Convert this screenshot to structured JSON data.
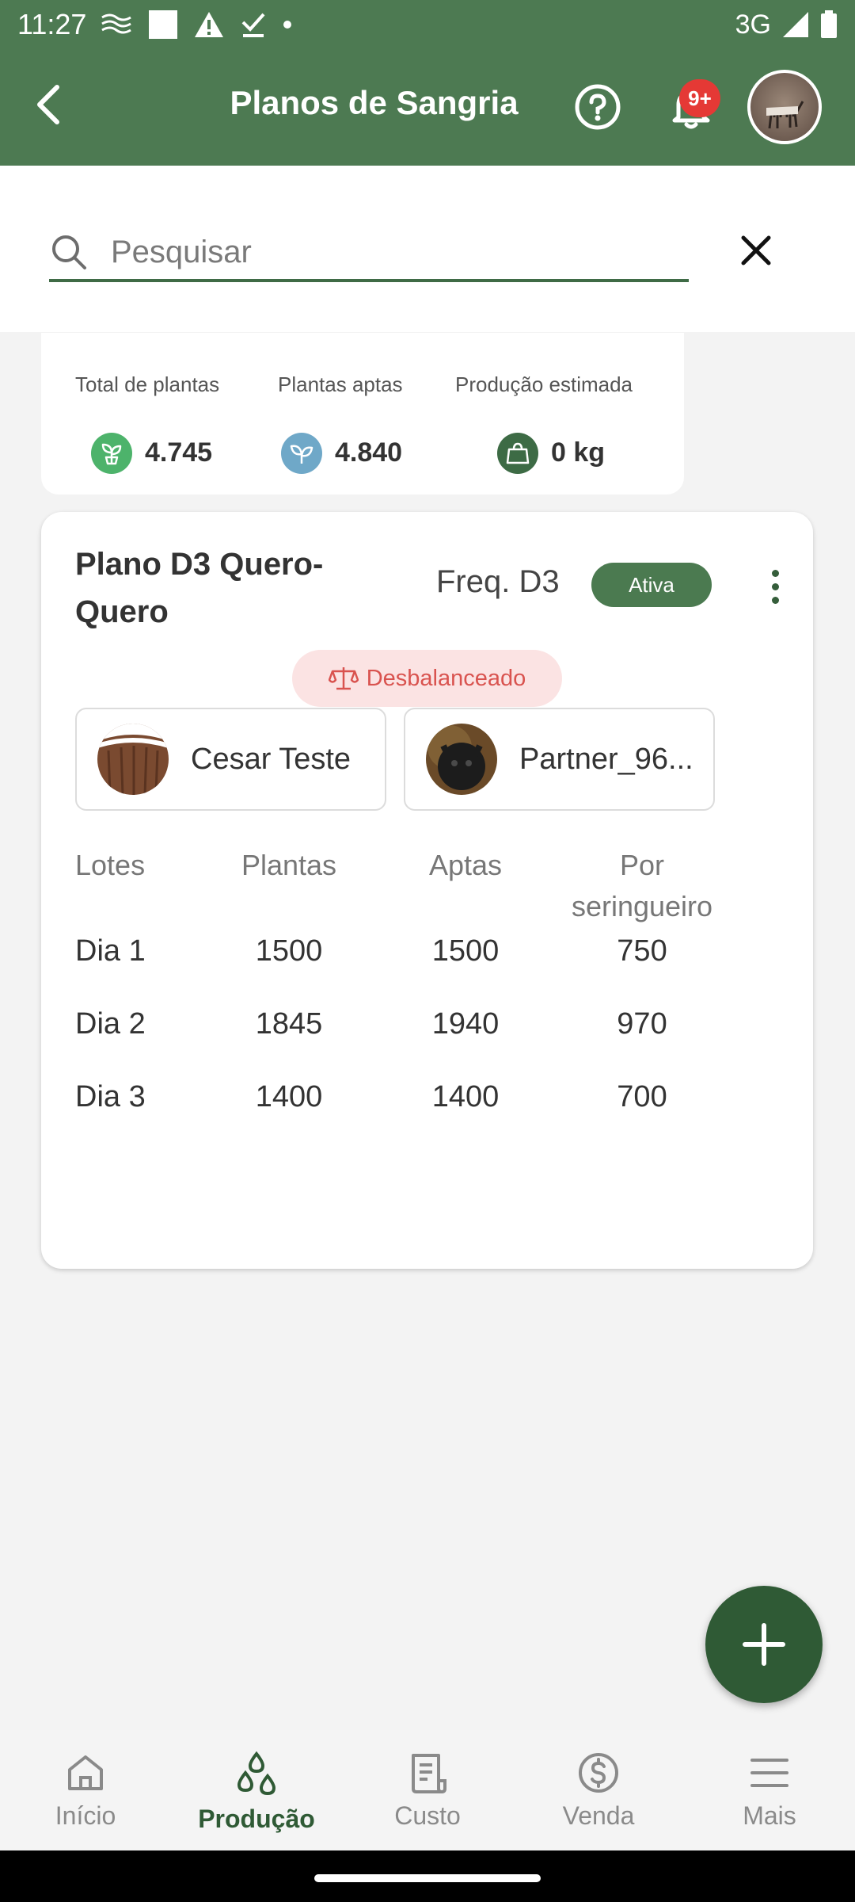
{
  "status_bar": {
    "time": "11:27",
    "network": "3G",
    "icons": [
      "signal-waves-icon",
      "square-icon",
      "warning-icon",
      "check-download-icon",
      "dot-icon"
    ]
  },
  "header": {
    "title": "Planos de Sangria",
    "notification_badge": "9+",
    "background_color": "#4d7a52"
  },
  "search": {
    "placeholder": "Pesquisar",
    "value": ""
  },
  "summary": {
    "total_label": "Total de plantas",
    "total_value": "4.745",
    "aptas_label": "Plantas aptas",
    "aptas_value": "4.840",
    "producao_label": "Produção estimada",
    "producao_value": "0 kg"
  },
  "plan": {
    "name": "Plano D3 Quero-Quero",
    "frequency": "Freq. D3",
    "status": "Ativa",
    "balance_status": "Desbalanceado",
    "tappers": [
      {
        "name": "Cesar Teste"
      },
      {
        "name": "Partner_96..."
      }
    ],
    "table": {
      "headers": [
        "Lotes",
        "Plantas",
        "Aptas",
        "Por seringueiro"
      ],
      "rows": [
        [
          "Dia 1",
          "1500",
          "1500",
          "750"
        ],
        [
          "Dia 2",
          "1845",
          "1940",
          "970"
        ],
        [
          "Dia 3",
          "1400",
          "1400",
          "700"
        ]
      ]
    }
  },
  "bottom_nav": {
    "items": [
      {
        "label": "Início",
        "icon": "home-icon"
      },
      {
        "label": "Produção",
        "icon": "drops-icon",
        "active": true
      },
      {
        "label": "Custo",
        "icon": "receipt-icon"
      },
      {
        "label": "Venda",
        "icon": "dollar-icon"
      },
      {
        "label": "Mais",
        "icon": "menu-icon"
      }
    ]
  },
  "colors": {
    "primary": "#4d7a52",
    "dark_green": "#2f5a35",
    "danger": "#d9534f",
    "danger_bg": "#fbe3e3"
  }
}
